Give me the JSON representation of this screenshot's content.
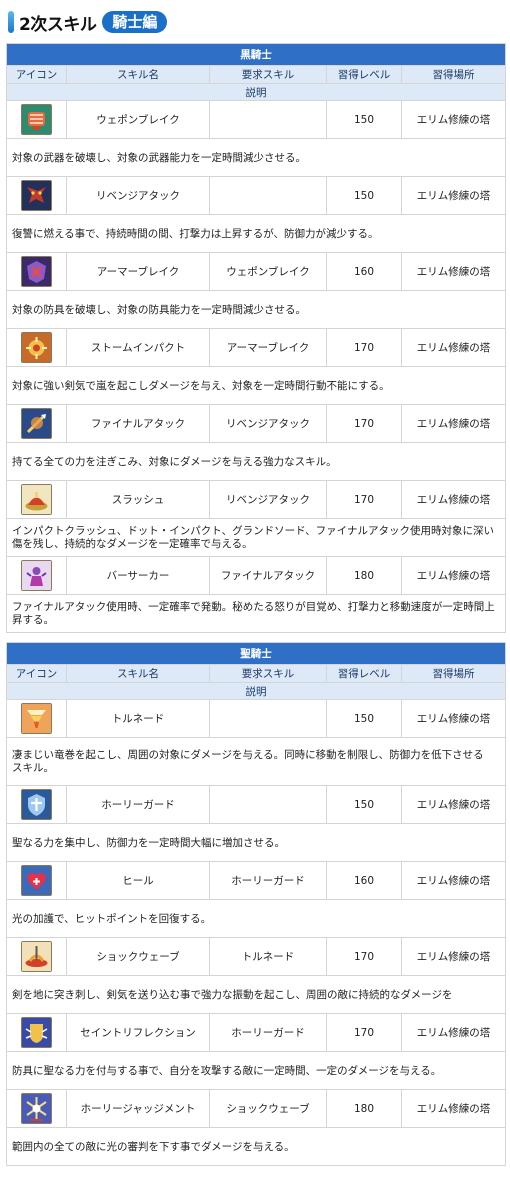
{
  "page": {
    "title": "2次スキル",
    "badge": "騎士編"
  },
  "columns": [
    "アイコン",
    "スキル名",
    "要求スキル",
    "習得レベル",
    "習得場所"
  ],
  "description_label": "説明",
  "sections": [
    {
      "title": "黒騎士",
      "skills": [
        {
          "icon": "broken-fist-icon",
          "name": "ウェポンブレイク",
          "required": "",
          "level": "150",
          "place": "エリム修練の塔",
          "description": "対象の武器を破壊し、対象の武器能力を一定時間減少させる。"
        },
        {
          "icon": "demon-rage-icon",
          "name": "リベンジアタック",
          "required": "",
          "level": "150",
          "place": "エリム修練の塔",
          "description": "復讐に燃える事で、持続時間の間、打撃力は上昇するが、防御力が減少する。"
        },
        {
          "icon": "armor-break-icon",
          "name": "アーマーブレイク",
          "required": "ウェポンブレイク",
          "level": "160",
          "place": "エリム修練の塔",
          "description": "対象の防具を破壊し、対象の防具能力を一定時間減少させる。"
        },
        {
          "icon": "storm-impact-icon",
          "name": "ストームインパクト",
          "required": "アーマーブレイク",
          "level": "170",
          "place": "エリム修練の塔",
          "description": "対象に強い剣気で嵐を起こしダメージを与え、対象を一定時間行動不能にする。"
        },
        {
          "icon": "final-attack-icon",
          "name": "ファイナルアタック",
          "required": "リベンジアタック",
          "level": "170",
          "place": "エリム修練の塔",
          "description": "持てる全ての力を注ぎこみ、対象にダメージを与える強力なスキル。"
        },
        {
          "icon": "slash-dome-icon",
          "name": "スラッシュ",
          "required": "リベンジアタック",
          "level": "170",
          "place": "エリム修練の塔",
          "description": "インパクトクラッシュ、ドット・インパクト、グランドソード、ファイナルアタック使用時対象に深い傷を残し、持続的なダメージを一定確率で与える。"
        },
        {
          "icon": "berserker-icon",
          "name": "バーサーカー",
          "required": "ファイナルアタック",
          "level": "180",
          "place": "エリム修練の塔",
          "description": "ファイナルアタック使用時、一定確率で発動。秘めたる怒りが目覚め、打撃力と移動速度が一定時間上昇する。"
        }
      ]
    },
    {
      "title": "聖騎士",
      "skills": [
        {
          "icon": "tornado-icon",
          "name": "トルネード",
          "required": "",
          "level": "150",
          "place": "エリム修練の塔",
          "description": "凄まじい竜巻を起こし、周囲の対象にダメージを与える。同時に移動を制限し、防御力を低下させる\nスキル。"
        },
        {
          "icon": "holy-shield-icon",
          "name": "ホーリーガード",
          "required": "",
          "level": "150",
          "place": "エリム修練の塔",
          "description": "聖なる力を集中し、防御力を一定時間大幅に増加させる。"
        },
        {
          "icon": "heal-heart-icon",
          "name": "ヒール",
          "required": "ホーリーガード",
          "level": "160",
          "place": "エリム修練の塔",
          "description": "光の加護で、ヒットポイントを回復する。"
        },
        {
          "icon": "shockwave-icon",
          "name": "ショックウェーブ",
          "required": "トルネード",
          "level": "170",
          "place": "エリム修練の塔",
          "description": "剣を地に突き刺し、剣気を送り込む事で強力な振動を起こし、周囲の敵に持続的なダメージを"
        },
        {
          "icon": "saint-reflect-icon",
          "name": "セイントリフレクション",
          "required": "ホーリーガード",
          "level": "170",
          "place": "エリム修練の塔",
          "description": "防具に聖なる力を付与する事で、自分を攻撃する敵に一定時間、一定のダメージを与える。"
        },
        {
          "icon": "holy-judgment-icon",
          "name": "ホーリージャッジメント",
          "required": "ショックウェーブ",
          "level": "180",
          "place": "エリム修練の塔",
          "description": "範囲内の全ての敵に光の審判を下す事でダメージを与える。"
        }
      ]
    }
  ]
}
